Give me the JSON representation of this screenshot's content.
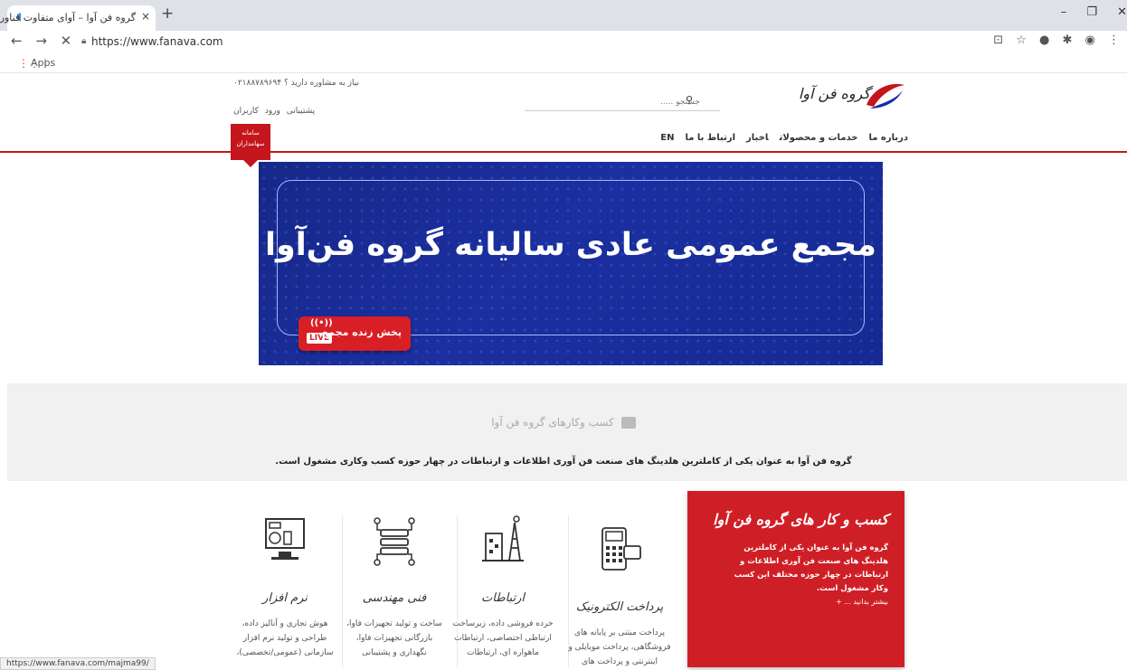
{
  "browser": {
    "tab_title": "گروه فن آوا – آوای متفاوت فناوری",
    "tab_close": "×",
    "new_tab": "+",
    "window_controls": "–  ❐  ✕",
    "nav_controls": "←  →  ✕",
    "url": "https://www.fanava.com",
    "ext_icons": "⊡ ☆ ● ✱ ◉ ⋮",
    "bookmark_apps_icon": "⋮⋮⋮",
    "bookmark_apps": "Apps",
    "status_url": "https://www.fanava.com/majma99/"
  },
  "header": {
    "phone": "نیاز به مشاوره دارید ؟ ۰۲۱۸۸۷۸۹۶۹۴",
    "links": "پشتیبانی    ورود کاربران",
    "search_placeholder": "جستجو .....",
    "logo_text": "گروه فن آوا",
    "nav": [
      "درباره ما",
      "خدمات و محصولات",
      "اخبار",
      "ارتباط با ما",
      "EN"
    ],
    "shareholders_line1": "سامانه",
    "shareholders_line2": "سهامداران"
  },
  "banner": {
    "title": "مجمع عمومی عادی سالیانه گروه فن‌آوا",
    "live_text": "پخش زنده مجمع",
    "live_badge": "LIVE",
    "live_signal": "((•))"
  },
  "section": {
    "title": "کسب وکارهای گروه فن آوا",
    "description": "گروه فن آوا به عنوان یکی از کاملترین هلدینگ های صنعت فن آوری اطلاعات و ارتباطات در چهار حوزه کسب وکاری مشغول است."
  },
  "cards": [
    {
      "title": "نرم افزار",
      "desc": "هوش تجاری و آنالیز داده، طراحی و تولید نرم افزار سازمانی (عمومی/تخصصی)،"
    },
    {
      "title": "فنی مهندسی",
      "desc": "ساخت و تولید تجهیزات فاوا، بازرگانی تجهیزات فاوا، نگهداری و پشتیبانی"
    },
    {
      "title": "ارتباطات",
      "desc": "خرده فروشی داده، زیرساخت ارتباطی اختصاصی، ارتباطات ماهواره ای، ارتباطات"
    },
    {
      "title": "پرداخت الکترونیک",
      "desc": "پرداخت مبتنی بر پایانه های فروشگاهی، پرداخت موبایلی و اینترنتی و پرداخت های"
    }
  ],
  "red_card": {
    "title": "کسب و کار های گروه فن آوا",
    "desc": "گروه فن آوا به عنوان یکی از کاملترین هلدینگ های صنعت فن آوری اطلاعات و ارتباطات در چهار حوزه مختلف این کسب وکار مشغول است.",
    "more": "بیشتر بدانید ... +"
  },
  "colors": {
    "brand_red": "#c4161c",
    "banner_blue": "#1b2fa0"
  }
}
